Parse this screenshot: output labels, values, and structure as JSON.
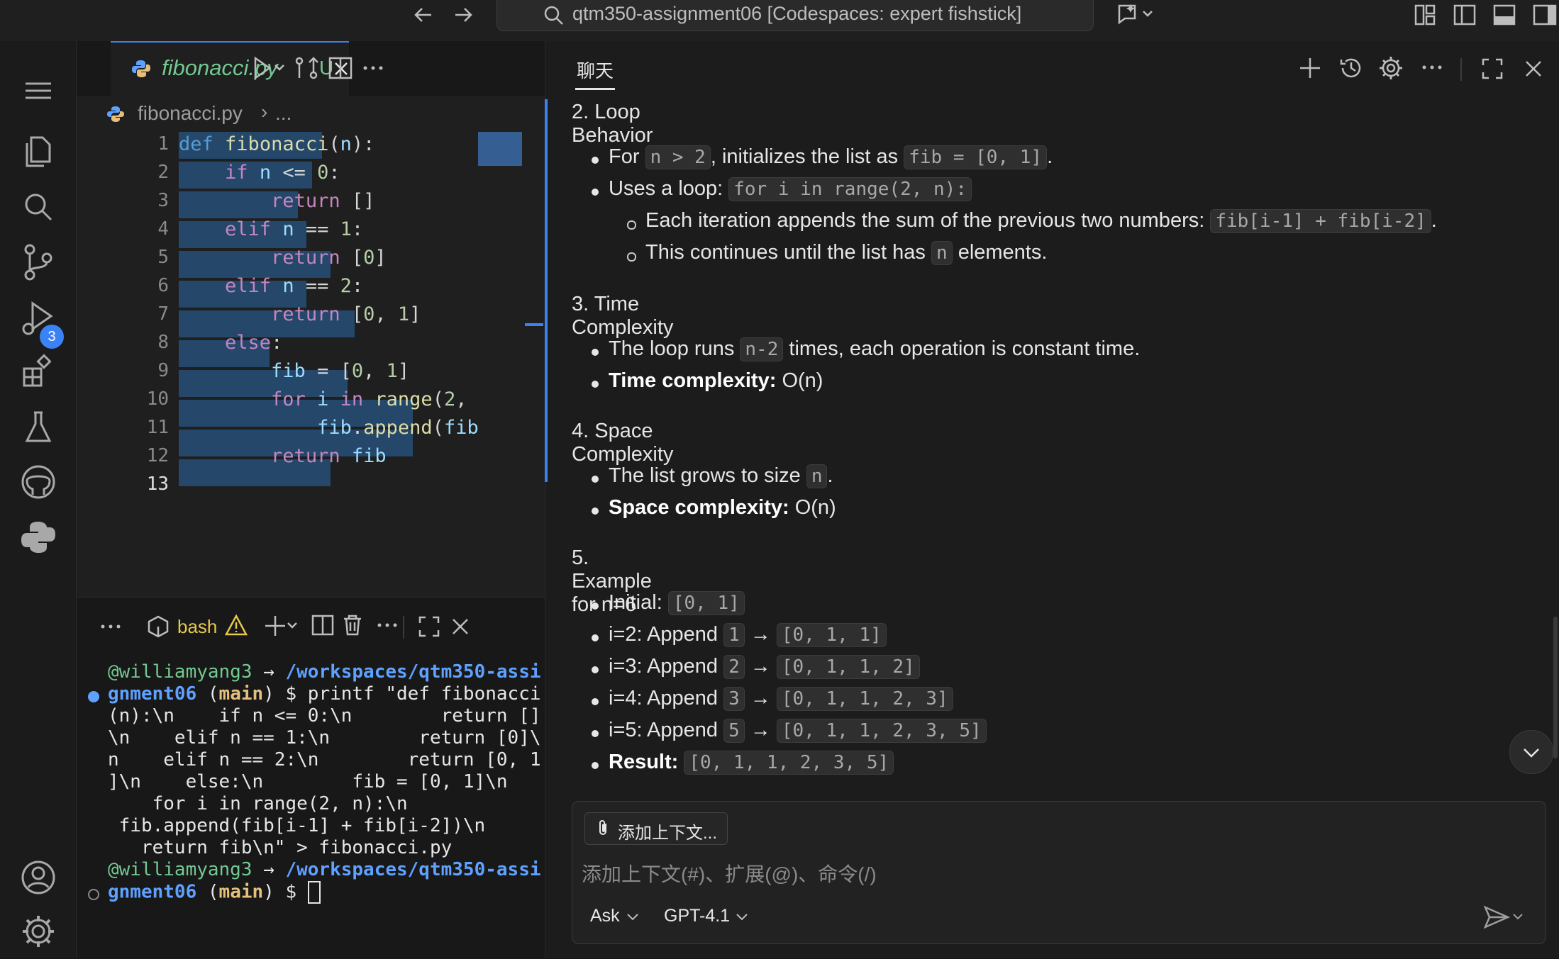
{
  "titlebar": {
    "search_text": "qtm350-assignment06 [Codespaces: expert fishstick]"
  },
  "activity": {
    "source_control_badge": "3"
  },
  "editor": {
    "tab_filename": "fibonacci.py",
    "tab_status": "U",
    "breadcrumb_file": "fibonacci.py",
    "breadcrumb_more": "...",
    "line_numbers": [
      "1",
      "2",
      "3",
      "4",
      "5",
      "6",
      "7",
      "8",
      "9",
      "10",
      "11",
      "12",
      "13"
    ]
  },
  "terminal": {
    "shell_label": "bash",
    "lines": [
      [
        "@williamyang3",
        " → ",
        "/workspaces/qtm350-assi"
      ],
      [
        "gnment06",
        " (",
        "main",
        ") $ printf \"def fibonacci"
      ],
      "(n):\\n    if n <= 0:\\n        return []",
      "\\n    elif n == 1:\\n        return [0]\\",
      "n    elif n == 2:\\n        return [0, 1",
      "]\\n    else:\\n        fib = [0, 1]\\n",
      "    for i in range(2, n):\\n",
      " fib.append(fib[i-1] + fib[i-2])\\n",
      "   return fib\\n\" > fibonacci.py",
      [
        "@williamyang3",
        " → ",
        "/workspaces/qtm350-assi"
      ],
      [
        "gnment06",
        " (",
        "main",
        ") $ "
      ]
    ]
  },
  "chat": {
    "tab_label": "聊天",
    "s2_title": "2. Loop Behavior",
    "s2_b1_a": "For ",
    "s2_b1_code1": "n > 2",
    "s2_b1_b": ", initializes the list as ",
    "s2_b1_code2": "fib = [0, 1]",
    "s2_b1_c": ".",
    "s2_b2_a": "Uses a loop: ",
    "s2_b2_code": "for i in range(2, n):",
    "s2_sub1_a": "Each iteration appends the sum of the previous two numbers: ",
    "s2_sub1_code": "fib[i-1] + fib[i-2]",
    "s2_sub1_b": ".",
    "s2_sub2_a": "This continues until the list has ",
    "s2_sub2_code": "n",
    "s2_sub2_b": " elements.",
    "s3_title": "3. Time Complexity",
    "s3_b1_a": "The loop runs ",
    "s3_b1_code": "n-2",
    "s3_b1_b": " times, each operation is constant time.",
    "s3_b2_bold": "Time complexity:",
    "s3_b2_rest": " O(n)",
    "s4_title": "4. Space Complexity",
    "s4_b1_a": "The list grows to size ",
    "s4_b1_code": "n",
    "s4_b1_b": ".",
    "s4_b2_bold": "Space complexity:",
    "s4_b2_rest": " O(n)",
    "s5_title": "5. Example for n=6",
    "ex_initial_label": "Initial: ",
    "ex_initial_code": "[0, 1]",
    "ex_rows": [
      {
        "label": "i=2: Append ",
        "n": "1",
        "arrow": " → ",
        "list": "[0, 1, 1]"
      },
      {
        "label": "i=3: Append ",
        "n": "2",
        "arrow": " → ",
        "list": "[0, 1, 1, 2]"
      },
      {
        "label": "i=4: Append ",
        "n": "3",
        "arrow": " → ",
        "list": "[0, 1, 1, 2, 3]"
      },
      {
        "label": "i=5: Append ",
        "n": "5",
        "arrow": " → ",
        "list": "[0, 1, 1, 2, 3, 5]"
      }
    ],
    "result_bold": "Result:",
    "result_code": "[0, 1, 1, 2, 3, 5]",
    "add_context_label": "添加上下文...",
    "input_placeholder": "添加上下文(#)、扩展(@)、命令(/)",
    "mode_label": "Ask",
    "model_label": "GPT-4.1"
  }
}
